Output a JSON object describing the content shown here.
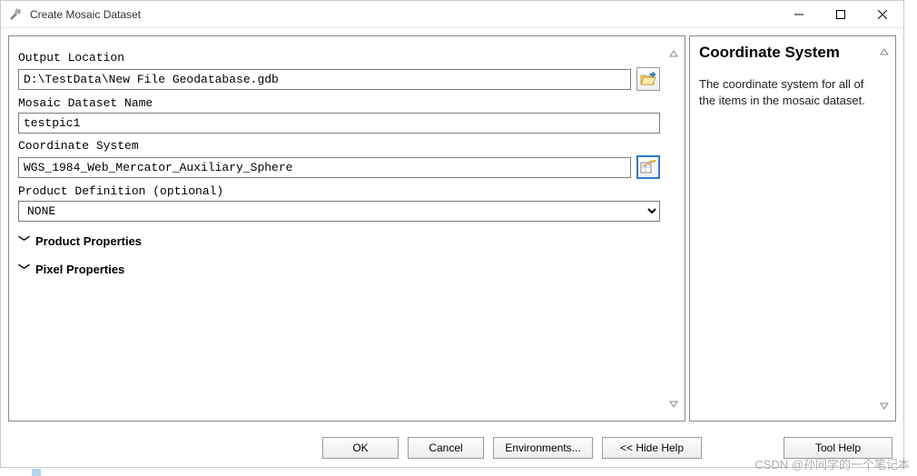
{
  "window": {
    "title": "Create Mosaic Dataset"
  },
  "form": {
    "output_location": {
      "label": "Output Location",
      "value": "D:\\TestData\\New File Geodatabase.gdb"
    },
    "mosaic_name": {
      "label": "Mosaic Dataset Name",
      "value": "testpic1"
    },
    "coord_system": {
      "label": "Coordinate System",
      "value": "WGS_1984_Web_Mercator_Auxiliary_Sphere"
    },
    "product_definition": {
      "label": "Product Definition (optional)",
      "value": "NONE"
    }
  },
  "sections": {
    "product_properties": "Product Properties",
    "pixel_properties": "Pixel Properties"
  },
  "help": {
    "title": "Coordinate System",
    "body": "The coordinate system for all of the items in the mosaic dataset."
  },
  "buttons": {
    "ok": "OK",
    "cancel": "Cancel",
    "environments": "Environments...",
    "hide_help": "<< Hide Help",
    "tool_help": "Tool Help"
  },
  "watermark": "CSDN @孙同学的一个笔记本"
}
